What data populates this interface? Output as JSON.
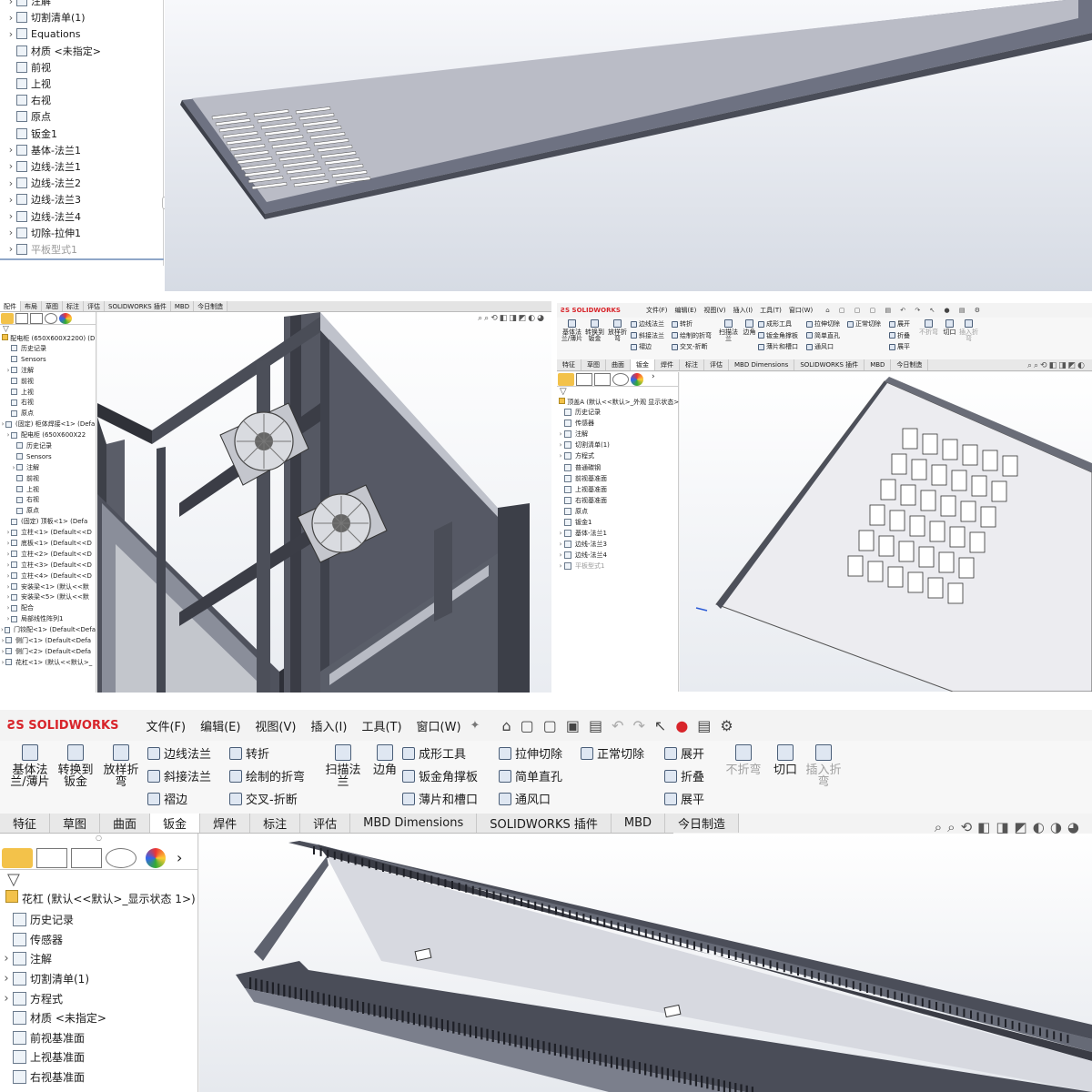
{
  "panel1": {
    "tree": [
      {
        "label": "注解",
        "arrow": true,
        "icon": "annotation-icon",
        "muted": false
      },
      {
        "label": "切割清单(1)",
        "arrow": true,
        "icon": "cut-list-icon",
        "muted": false
      },
      {
        "label": "Equations",
        "arrow": true,
        "icon": "equations-icon",
        "muted": false
      },
      {
        "label": "材质 <未指定>",
        "arrow": false,
        "icon": "material-icon",
        "muted": false
      },
      {
        "label": "前视",
        "arrow": false,
        "icon": "plane-icon",
        "muted": false
      },
      {
        "label": "上视",
        "arrow": false,
        "icon": "plane-icon",
        "muted": false
      },
      {
        "label": "右视",
        "arrow": false,
        "icon": "plane-icon",
        "muted": false
      },
      {
        "label": "原点",
        "arrow": false,
        "icon": "origin-icon",
        "muted": false
      },
      {
        "label": "钣金1",
        "arrow": false,
        "icon": "sheet-metal-icon",
        "muted": false
      },
      {
        "label": "基体-法兰1",
        "arrow": true,
        "icon": "base-flange-icon",
        "muted": false
      },
      {
        "label": "边线-法兰1",
        "arrow": true,
        "icon": "edge-flange-icon",
        "muted": false
      },
      {
        "label": "边线-法兰2",
        "arrow": true,
        "icon": "edge-flange-icon",
        "muted": false
      },
      {
        "label": "边线-法兰3",
        "arrow": true,
        "icon": "edge-flange-icon",
        "muted": false
      },
      {
        "label": "边线-法兰4",
        "arrow": true,
        "icon": "edge-flange-icon",
        "muted": false
      },
      {
        "label": "切除-拉伸1",
        "arrow": true,
        "icon": "cut-extrude-icon",
        "muted": false
      },
      {
        "label": "平板型式1",
        "arrow": true,
        "icon": "flat-pattern-icon",
        "muted": true
      }
    ]
  },
  "panel2": {
    "tabs": [
      "配件",
      "布局",
      "草图",
      "标注",
      "评估",
      "SOLIDWORKS 插件",
      "MBD",
      "今日制造"
    ],
    "root": "配电柜 (650X600X2200) (D",
    "tree": [
      {
        "label": "历史记录",
        "indent": 1,
        "arrow": false
      },
      {
        "label": "Sensors",
        "indent": 1,
        "arrow": false
      },
      {
        "label": "注解",
        "indent": 1,
        "arrow": true
      },
      {
        "label": "前视",
        "indent": 1,
        "arrow": false
      },
      {
        "label": "上视",
        "indent": 1,
        "arrow": false
      },
      {
        "label": "右视",
        "indent": 1,
        "arrow": false
      },
      {
        "label": "原点",
        "indent": 1,
        "arrow": false
      },
      {
        "label": "(固定) 柜体焊接<1> (Defa",
        "indent": 0,
        "arrow": true
      },
      {
        "label": "配电柜 (650X600X22",
        "indent": 1,
        "arrow": true
      },
      {
        "label": "历史记录",
        "indent": 2,
        "arrow": false
      },
      {
        "label": "Sensors",
        "indent": 2,
        "arrow": false
      },
      {
        "label": "注解",
        "indent": 2,
        "arrow": true
      },
      {
        "label": "前视",
        "indent": 2,
        "arrow": false
      },
      {
        "label": "上视",
        "indent": 2,
        "arrow": false
      },
      {
        "label": "右视",
        "indent": 2,
        "arrow": false
      },
      {
        "label": "原点",
        "indent": 2,
        "arrow": false
      },
      {
        "label": "(固定) 顶板<1> (Defa",
        "indent": 1,
        "arrow": false
      },
      {
        "label": "立柱<1> (Default<<D",
        "indent": 1,
        "arrow": true
      },
      {
        "label": "底板<1> (Default<<D",
        "indent": 1,
        "arrow": true
      },
      {
        "label": "立柱<2> (Default<<D",
        "indent": 1,
        "arrow": true
      },
      {
        "label": "立柱<3> (Default<<D",
        "indent": 1,
        "arrow": true
      },
      {
        "label": "立柱<4> (Default<<D",
        "indent": 1,
        "arrow": true
      },
      {
        "label": "安装梁<1> (默认<<默",
        "indent": 1,
        "arrow": true
      },
      {
        "label": "安装梁<5> (默认<<默",
        "indent": 1,
        "arrow": true
      },
      {
        "label": "配合",
        "indent": 1,
        "arrow": true
      },
      {
        "label": "局部线性阵列1",
        "indent": 1,
        "arrow": true
      },
      {
        "label": "门铰配<1> (Default<Defa",
        "indent": 0,
        "arrow": true
      },
      {
        "label": "侧门<1> (Default<Defa",
        "indent": 0,
        "arrow": true
      },
      {
        "label": "侧门<2> (Default<Defa",
        "indent": 0,
        "arrow": true
      },
      {
        "label": "花杠<1> (默认<<默认>_",
        "indent": 0,
        "arrow": true
      }
    ]
  },
  "panel3": {
    "brand": "SOLIDWORKS",
    "menus": [
      "文件(F)",
      "编辑(E)",
      "视图(V)",
      "插入(I)",
      "工具(T)",
      "窗口(W)"
    ],
    "ribbon": {
      "big": [
        {
          "label": "基体法\n兰/薄片"
        },
        {
          "label": "转换到\n钣金"
        },
        {
          "label": "放样折\n弯"
        }
      ],
      "col1": [
        "边线法兰",
        "斜接法兰",
        "褶边"
      ],
      "col2": [
        "转折",
        "绘制的折弯",
        "交叉-折断"
      ],
      "sweep": "扫描法\n兰",
      "corner": "边角",
      "col3": [
        "成形工具",
        "钣金角撑板",
        "薄片和槽口"
      ],
      "col4": [
        "拉伸切除",
        "简单直孔",
        "通风口"
      ],
      "col5": [
        "正常切除"
      ],
      "col6": [
        "展开",
        "折叠",
        "展平"
      ],
      "nofold": "不折弯",
      "cut": "切口",
      "insert": "插入折\n弯"
    },
    "tabs": [
      "特征",
      "草图",
      "曲面",
      "钣金",
      "焊件",
      "标注",
      "评估",
      "MBD Dimensions",
      "SOLIDWORKS 插件",
      "MBD",
      "今日制造"
    ],
    "root": "顶盖A (默认<<默认>_外观 显示状态>",
    "tree": [
      {
        "label": "历史记录",
        "arrow": false
      },
      {
        "label": "传感器",
        "arrow": false
      },
      {
        "label": "注解",
        "arrow": true
      },
      {
        "label": "切割清单(1)",
        "arrow": true
      },
      {
        "label": "方程式",
        "arrow": true
      },
      {
        "label": "普通碳钢",
        "arrow": false
      },
      {
        "label": "前视基准面",
        "arrow": false
      },
      {
        "label": "上视基准面",
        "arrow": false
      },
      {
        "label": "右视基准面",
        "arrow": false
      },
      {
        "label": "原点",
        "arrow": false
      },
      {
        "label": "钣金1",
        "arrow": false
      },
      {
        "label": "基体-法兰1",
        "arrow": true
      },
      {
        "label": "边线-法兰3",
        "arrow": true
      },
      {
        "label": "边线-法兰4",
        "arrow": true
      },
      {
        "label": "平板型式1",
        "arrow": true,
        "muted": true
      }
    ]
  },
  "panel4": {
    "brand": "SOLIDWORKS",
    "menus": [
      "文件(F)",
      "编辑(E)",
      "视图(V)",
      "插入(I)",
      "工具(T)",
      "窗口(W)"
    ],
    "ribbon": {
      "big": [
        {
          "label": "基体法\n兰/薄片"
        },
        {
          "label": "转换到\n钣金"
        },
        {
          "label": "放样折\n弯"
        }
      ],
      "col1": [
        "边线法兰",
        "斜接法兰",
        "褶边"
      ],
      "col2": [
        "转折",
        "绘制的折弯",
        "交叉-折断"
      ],
      "sweep": "扫描法\n兰",
      "corner": "边角",
      "col3": [
        "成形工具",
        "钣金角撑板",
        "薄片和槽口"
      ],
      "col4": [
        "拉伸切除",
        "简单直孔",
        "通风口"
      ],
      "col5": [
        "正常切除"
      ],
      "col6": [
        "展开",
        "折叠",
        "展平"
      ],
      "nofold": "不折弯",
      "cut": "切口",
      "insert": "插入折\n弯"
    },
    "tabs": [
      "特征",
      "草图",
      "曲面",
      "钣金",
      "焊件",
      "标注",
      "评估",
      "MBD Dimensions",
      "SOLIDWORKS 插件",
      "MBD",
      "今日制造"
    ],
    "root": "花杠 (默认<<默认>_显示状态 1>)",
    "tree": [
      {
        "label": "历史记录",
        "arrow": false
      },
      {
        "label": "传感器",
        "arrow": false
      },
      {
        "label": "注解",
        "arrow": true
      },
      {
        "label": "切割清单(1)",
        "arrow": true
      },
      {
        "label": "方程式",
        "arrow": true
      },
      {
        "label": "材质 <未指定>",
        "arrow": false
      },
      {
        "label": "前视基准面",
        "arrow": false
      },
      {
        "label": "上视基准面",
        "arrow": false
      },
      {
        "label": "右视基准面",
        "arrow": false
      }
    ]
  },
  "colors": {
    "accent_red": "#d8242a",
    "viewport_top": "#f4f6fa",
    "viewport_bottom": "#c9d1dd",
    "metal_dark": "#5b5f6c",
    "metal_mid": "#8b8f9c"
  }
}
